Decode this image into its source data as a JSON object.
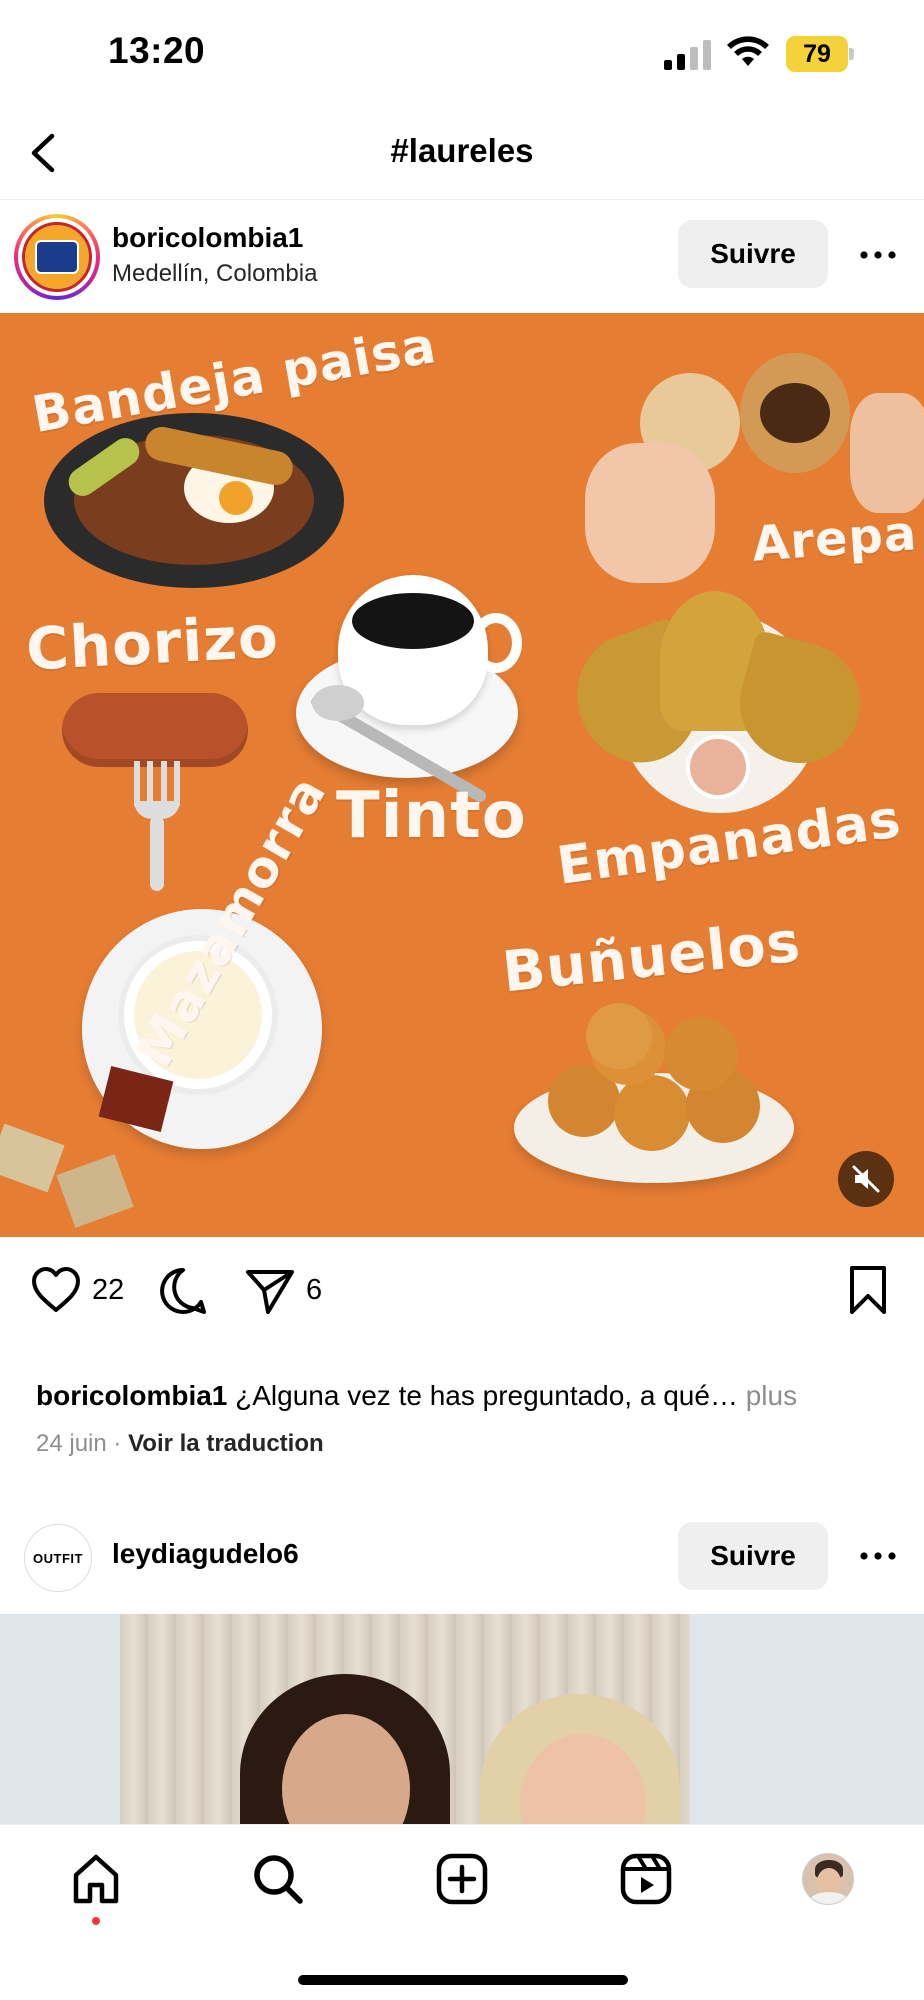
{
  "status_bar": {
    "time": "13:20",
    "battery": "79"
  },
  "header": {
    "title": "#laureles"
  },
  "post1": {
    "username": "boricolombia1",
    "location": "Medellín, Colombia",
    "follow_label": "Suivre",
    "image_labels": {
      "bandeja": "Bandeja paisa",
      "arepa": "Arepa",
      "chorizo": "Chorizo",
      "tinto": "Tinto",
      "empanadas": "Empanadas",
      "bunuelos": "Buñuelos",
      "mazamorra": "Mazamorra"
    },
    "likes": "22",
    "shares": "6",
    "caption_user": "boricolombia1",
    "caption_text": " ¿Alguna vez te has preguntado, a qué…",
    "caption_more": " plus",
    "date": "24 juin",
    "translate": "Voir la traduction"
  },
  "post2": {
    "username": "leydiagudelo6",
    "follow_label": "Suivre",
    "avatar_text": "OUTFIT"
  },
  "colors": {
    "post_background": "#e57d33",
    "follow_button": "#efefef",
    "notification_dot": "#ff3040"
  },
  "icons": [
    "back-icon",
    "more-icon",
    "heart-icon",
    "comment-icon",
    "share-icon",
    "bookmark-icon",
    "mute-icon",
    "home-icon",
    "search-icon",
    "create-icon",
    "reels-icon",
    "profile-icon"
  ]
}
